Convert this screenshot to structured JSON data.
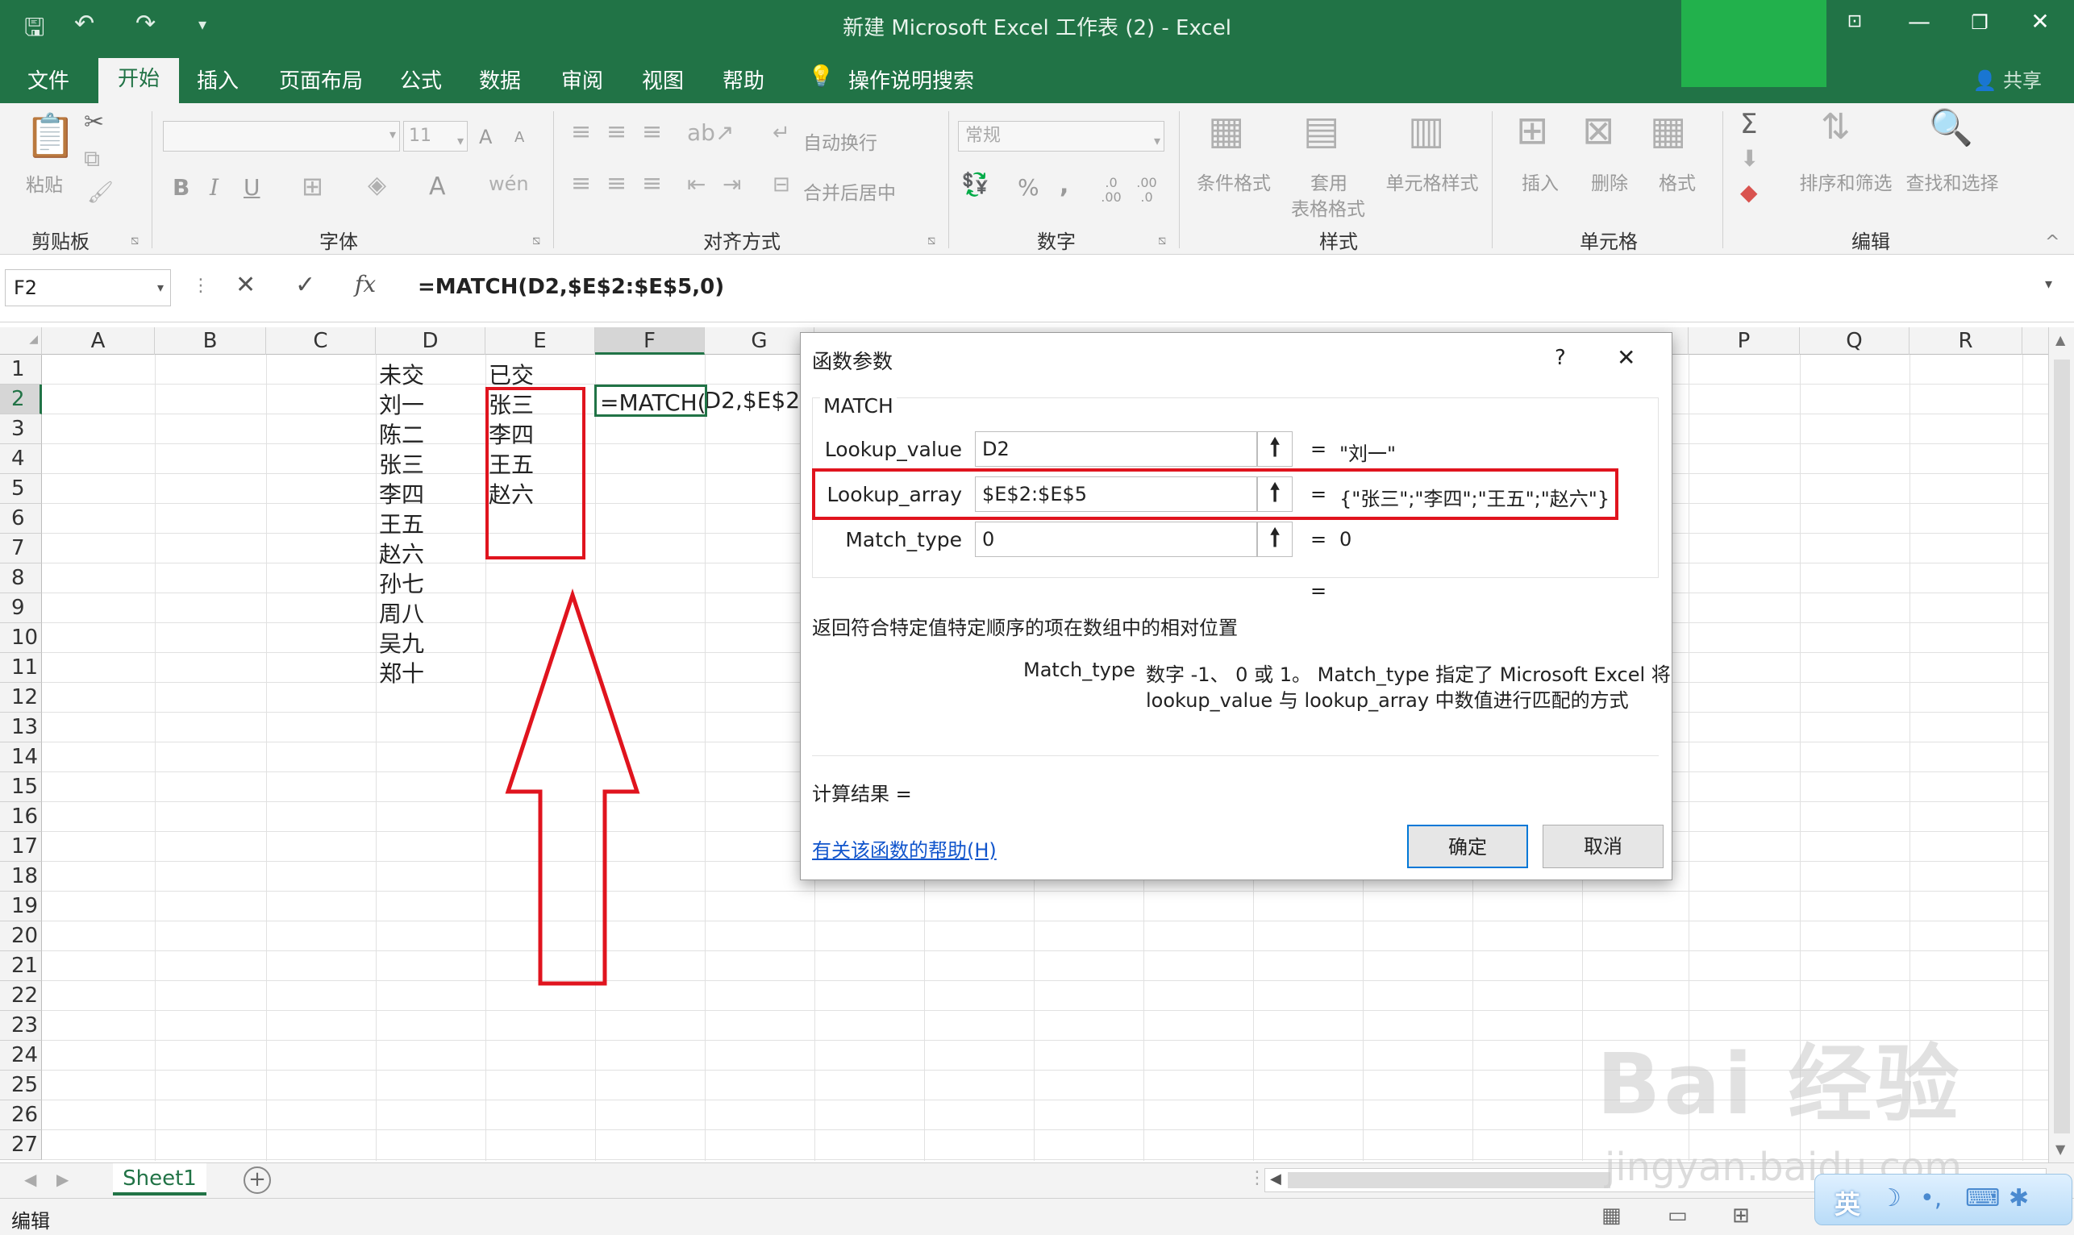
{
  "window": {
    "title": "新建 Microsoft Excel 工作表 (2)  -  Excel",
    "quick_access": {
      "save_icon": "save-icon",
      "undo_icon": "undo-icon",
      "redo_icon": "redo-icon",
      "customize_icon": "customize-icon"
    },
    "controls": {
      "ribbon_display": "ribbon-display-icon",
      "minimize": "minimize-icon",
      "restore": "restore-icon",
      "close": "close-icon"
    }
  },
  "ribbon": {
    "tabs": [
      "文件",
      "开始",
      "插入",
      "页面布局",
      "公式",
      "数据",
      "审阅",
      "视图",
      "帮助"
    ],
    "active_tab": "开始",
    "tell_me": "操作说明搜索",
    "share": "共享",
    "groups": {
      "clipboard": {
        "label": "剪贴板",
        "paste": "粘贴"
      },
      "font": {
        "label": "字体",
        "size": "11",
        "bold": "B",
        "italic": "I",
        "underline": "U",
        "grow": "A",
        "shrink": "A",
        "font_color": "A"
      },
      "alignment": {
        "label": "对齐方式",
        "wrap": "自动换行",
        "merge": "合并后居中"
      },
      "number": {
        "label": "数字",
        "format": "常规",
        "percent": "%",
        "comma": ",",
        "inc_decimal": ".0 .00",
        "dec_decimal": ".00 .0"
      },
      "styles": {
        "label": "样式",
        "conditional": "条件格式",
        "table_line1": "套用",
        "table_line2": "表格格式",
        "cell_styles": "单元格样式"
      },
      "cells": {
        "label": "单元格",
        "insert": "插入",
        "delete": "删除",
        "format": "格式"
      },
      "editing": {
        "label": "编辑",
        "sort": "排序和筛选",
        "find": "查找和选择"
      }
    }
  },
  "formula_bar": {
    "name_box": "F2",
    "cancel": "✕",
    "enter": "✓",
    "fx": "fx",
    "formula": "=MATCH(D2,$E$2:$E$5,0)"
  },
  "grid": {
    "columns": [
      "A",
      "B",
      "C",
      "D",
      "E",
      "F",
      "G",
      "P",
      "Q",
      "R"
    ],
    "rows": [
      "1",
      "2",
      "3",
      "4",
      "5",
      "6",
      "7",
      "8",
      "9",
      "10",
      "11",
      "12",
      "13",
      "14",
      "15",
      "16",
      "17",
      "18",
      "19",
      "20",
      "21",
      "22",
      "23",
      "24",
      "25",
      "26",
      "27"
    ],
    "col_d": [
      "未交",
      "刘一",
      "陈二",
      "张三",
      "李四",
      "王五",
      "赵六",
      "孙七",
      "周八",
      "吴九",
      "郑十"
    ],
    "col_e": [
      "已交",
      "张三",
      "李四",
      "王五",
      "赵六"
    ],
    "f2_text": "=MATCH(D2,$E$2:$E"
  },
  "dialog": {
    "title": "函数参数",
    "help": "?",
    "close": "✕",
    "function_name": "MATCH",
    "args": [
      {
        "label": "Lookup_value",
        "value": "D2",
        "result": "\"刘一\""
      },
      {
        "label": "Lookup_array",
        "value": "$E$2:$E$5",
        "result": "{\"张三\";\"李四\";\"王五\";\"赵六\"}"
      },
      {
        "label": "Match_type",
        "value": "0",
        "result": "0"
      }
    ],
    "equals": "=",
    "description": "返回符合特定值特定顺序的项在数组中的相对位置",
    "param_name": "Match_type",
    "param_desc_line1": "数字 -1、 0 或 1。 Match_type 指定了 Microsoft Excel 将",
    "param_desc_line2": "lookup_value 与 lookup_array 中数值进行匹配的方式",
    "result_label": "计算结果 =",
    "help_link": "有关该函数的帮助(H)",
    "ok": "确定",
    "cancel": "取消"
  },
  "sheets": {
    "tabs": [
      "Sheet1"
    ],
    "add": "+"
  },
  "status": {
    "mode": "编辑"
  },
  "watermark": {
    "text": "Bai 经验",
    "url": "jingyan.baidu.com",
    "ime": "英"
  },
  "colors": {
    "excel_green": "#217346",
    "highlight_red": "#e0141e",
    "link_blue": "#1155cc"
  }
}
